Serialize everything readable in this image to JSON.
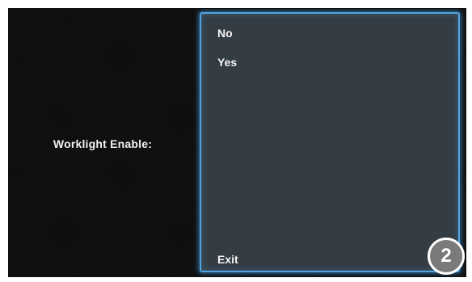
{
  "setting": {
    "label": "Worklight Enable:"
  },
  "options": [
    {
      "label": "No"
    },
    {
      "label": "Yes"
    }
  ],
  "exit_label": "Exit",
  "step_badge": "2",
  "colors": {
    "screen_background": "#0a0a0a",
    "panel_background": "#343c44",
    "panel_glow": "#4fa3df",
    "text": "#f4f4f4",
    "badge": "#7a7a7a"
  }
}
